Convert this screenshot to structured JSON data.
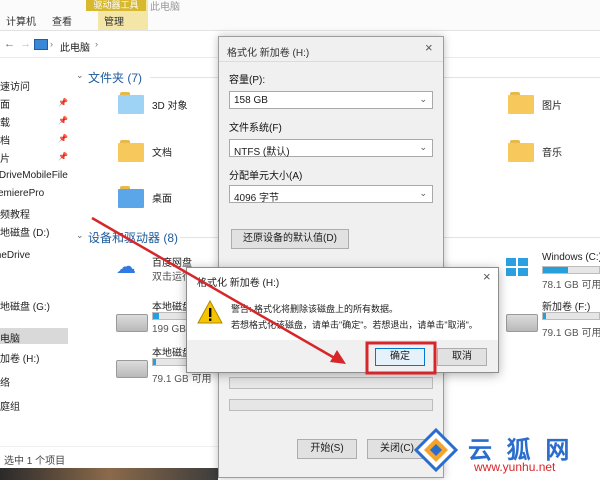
{
  "ribbon": {
    "tabs": [
      "计算机",
      "查看",
      "管理"
    ],
    "contextual_group": "驱动器工具",
    "window_title": "此电脑"
  },
  "address": {
    "crumb": "此电脑"
  },
  "sidebar": {
    "items": [
      "快速访问",
      "桌面",
      "下载",
      "文档",
      "图片",
      "OneDriveMobileFile",
      "PremierePro",
      "视频教程",
      "本地磁盘 (D:)",
      "OneDrive",
      "此电脑",
      "本地磁盘 (G:)",
      "新加卷 (H:)",
      "网络",
      "家庭组"
    ]
  },
  "main": {
    "folders_header": "文件夹 (7)",
    "folders": [
      "3D 对象",
      "图片",
      "文档",
      "音乐",
      "桌面"
    ],
    "devices_header": "设备和驱动器 (8)",
    "drives": [
      {
        "name": "百度网盘",
        "sub": "双击运行"
      },
      {
        "name": "Windows (C:)",
        "cap": "78.1 GB 可用",
        "used": 0.45
      },
      {
        "name": "本地磁盘",
        "cap": "199 GB",
        "used": 0.1
      },
      {
        "name": "新加卷 (F:)",
        "cap": "79.1 GB 可用",
        "used": 0.05
      },
      {
        "name": "本地磁盘",
        "cap": "79.1 GB 可用",
        "used": 0.05
      }
    ]
  },
  "status": {
    "selected": "选中 1 个项目"
  },
  "format_dialog": {
    "title": "格式化 新加卷 (H:)",
    "capacity_label": "容量(P):",
    "capacity_value": "158 GB",
    "fs_label": "文件系统(F)",
    "fs_value": "NTFS (默认)",
    "alloc_label": "分配单元大小(A)",
    "alloc_value": "4096 字节",
    "restore_button": "还原设备的默认值(D)",
    "start_button": "开始(S)",
    "close_button": "关闭(C)"
  },
  "warning_dialog": {
    "title": "格式化 新加卷 (H:)",
    "line1": "警告: 格式化将删除该磁盘上的所有数据。",
    "line2": "若想格式化该磁盘，请单击\"确定\"。若想退出，请单击\"取消\"。",
    "ok_button": "确定",
    "cancel_button": "取消"
  },
  "watermark": {
    "brand": "云 狐 网",
    "url": "www.yunhu.net"
  },
  "colors": {
    "accent": "#26a0da",
    "annotation": "#d7262a",
    "section": "#1e5a9c",
    "brand": "#2a6dcc"
  }
}
